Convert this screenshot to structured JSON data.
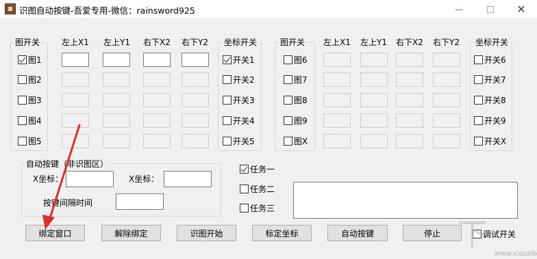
{
  "window": {
    "title": "识图自动按键-吾爱专用-微信：rainsword925",
    "minimize_glyph": "—",
    "maximize_glyph": "☐",
    "close_glyph": "✕"
  },
  "left_group": {
    "title": "图开关",
    "items": [
      {
        "label": "图1",
        "checked": true
      },
      {
        "label": "图2",
        "checked": false
      },
      {
        "label": "图3",
        "checked": false
      },
      {
        "label": "图4",
        "checked": false
      },
      {
        "label": "图5",
        "checked": false
      }
    ]
  },
  "left_columns": [
    "左上X1",
    "左上Y1",
    "右下X2",
    "右下Y2"
  ],
  "left_switch_group": {
    "title": "坐标开关",
    "items": [
      {
        "label": "开关1",
        "checked": true
      },
      {
        "label": "开关2",
        "checked": false
      },
      {
        "label": "开关3",
        "checked": false
      },
      {
        "label": "开关4",
        "checked": false
      },
      {
        "label": "开关5",
        "checked": false
      }
    ]
  },
  "right_group": {
    "title": "图开关",
    "items": [
      {
        "label": "图6",
        "checked": false
      },
      {
        "label": "图7",
        "checked": false
      },
      {
        "label": "图8",
        "checked": false
      },
      {
        "label": "图9",
        "checked": false
      },
      {
        "label": "图X",
        "checked": false
      }
    ]
  },
  "right_columns": [
    "左上X1",
    "左上Y1",
    "右下X2",
    "右下Y2"
  ],
  "right_switch_group": {
    "title": "坐标开关",
    "items": [
      {
        "label": "开关6",
        "checked": false
      },
      {
        "label": "开关7",
        "checked": false
      },
      {
        "label": "开关8",
        "checked": false
      },
      {
        "label": "开关9",
        "checked": false
      },
      {
        "label": "开关X",
        "checked": false
      }
    ]
  },
  "auto_key_group": {
    "title": "自动按键（非识图区）",
    "x_label": "X坐标：",
    "y_label": "X坐标：",
    "interval_label": "按键间隔时间",
    "x_value": "",
    "y_value": "",
    "interval_value": ""
  },
  "tasks": [
    {
      "label": "任务一",
      "checked": true
    },
    {
      "label": "任务二",
      "checked": false
    },
    {
      "label": "任务三",
      "checked": false
    }
  ],
  "log_text": "",
  "buttons": {
    "bind_window": "绑定窗口",
    "unbind": "解除绑定",
    "start_recognize": "识图开始",
    "calibrate": "标定坐标",
    "auto_press": "自动按键",
    "stop": "停止"
  },
  "debug_switch": {
    "label": "调试开关",
    "checked": false
  },
  "watermark": {
    "glyph": "下",
    "url": "www.xiazaiba.com"
  },
  "colors": {
    "annotation_arrow": "#d9302a"
  }
}
